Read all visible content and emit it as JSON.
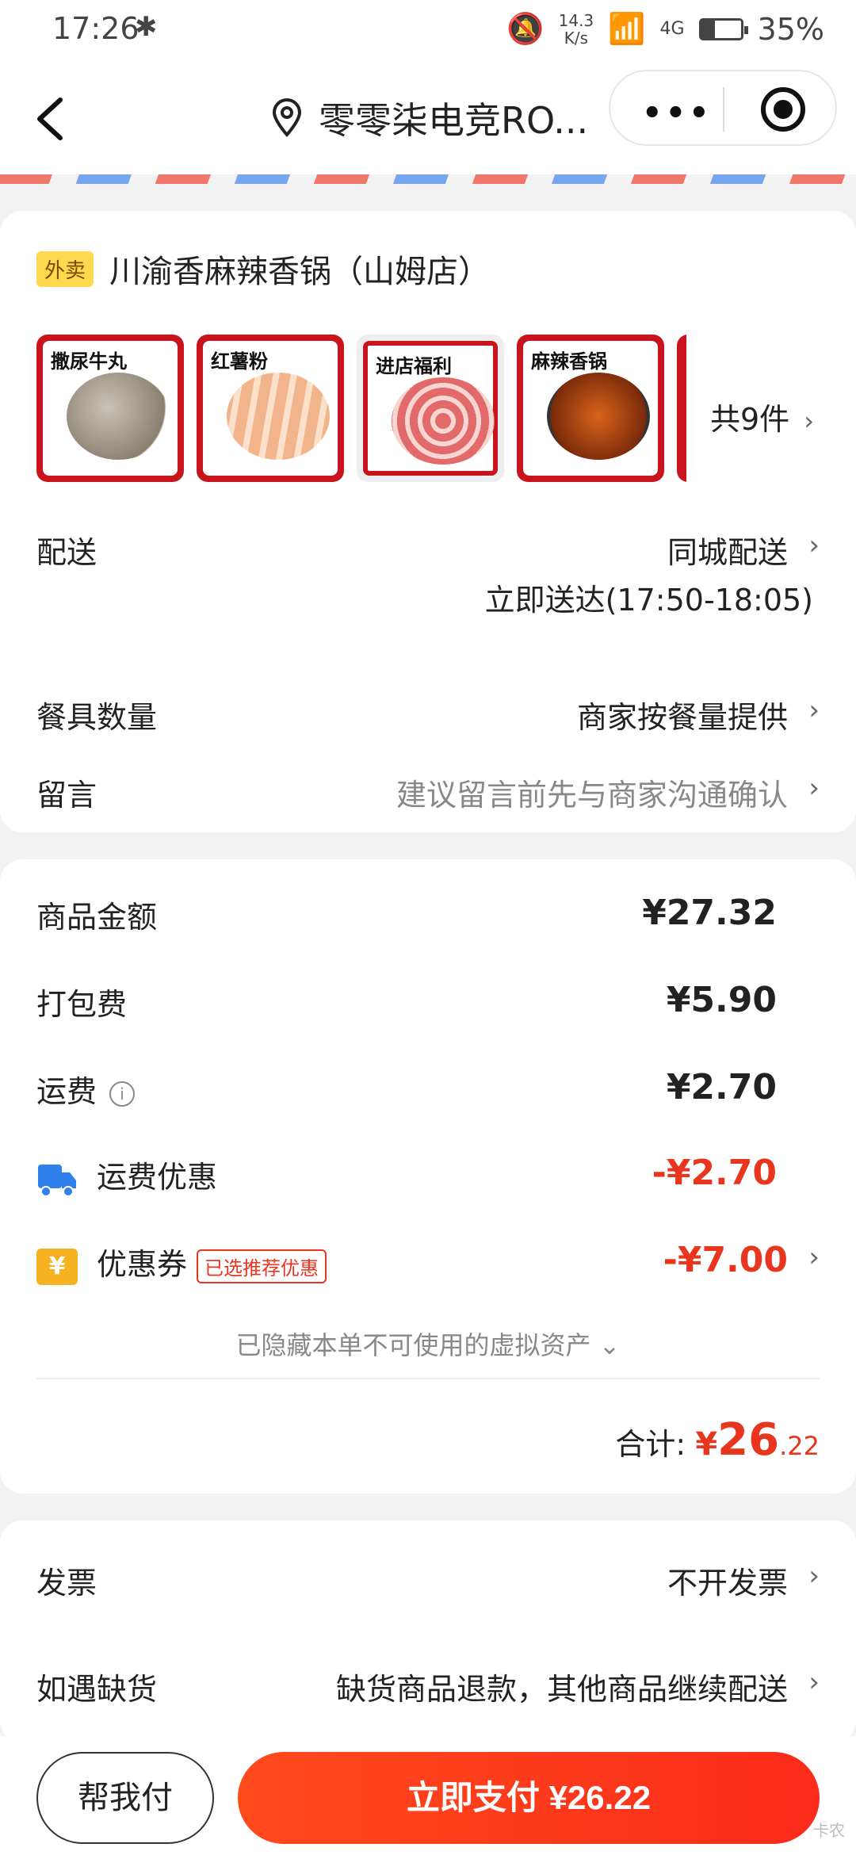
{
  "status_bar": {
    "time": "17:26",
    "bluetooth": "✱",
    "net_speed_value": "14.3",
    "net_speed_unit": "K/s",
    "signal": "4G",
    "battery": "35%"
  },
  "nav": {
    "title": "零零柒电竞RO...",
    "more_label": "•••"
  },
  "store": {
    "tag": "外卖",
    "name": "川渝香麻辣香锅（山姆店）"
  },
  "items": {
    "thumbs": [
      {
        "title": "撒尿牛丸"
      },
      {
        "title": "红薯粉"
      },
      {
        "title": "进店福利"
      },
      {
        "title": "麻辣香锅"
      }
    ],
    "count_label": "共9件"
  },
  "delivery": {
    "label": "配送",
    "method": "同城配送",
    "time": "立即送达(17:50-18:05)"
  },
  "tableware": {
    "label": "餐具数量",
    "value": "商家按餐量提供"
  },
  "message": {
    "label": "留言",
    "placeholder": "建议留言前先与商家沟通确认"
  },
  "fees": {
    "goods": {
      "label": "商品金额",
      "value": "¥27.32"
    },
    "packing": {
      "label": "打包费",
      "value": "¥5.90"
    },
    "shipping": {
      "label": "运费",
      "value": "¥2.70"
    },
    "shipping_discount": {
      "label": "运费优惠",
      "value": "-¥2.70"
    },
    "coupon": {
      "label": "优惠券",
      "badge": "已选推荐优惠",
      "value": "-¥7.00"
    }
  },
  "hidden_note": "已隐藏本单不可使用的虚拟资产 ⌄",
  "total": {
    "label": "合计:",
    "currency": "¥",
    "integer": "26",
    "decimal": ".22"
  },
  "invoice": {
    "label": "发票",
    "value": "不开发票"
  },
  "out_of_stock": {
    "label": "如遇缺货",
    "value": "缺货商品退款，其他商品继续配送"
  },
  "bottom": {
    "help_label": "帮我付",
    "pay_label": "立即支付 ¥26.22"
  },
  "watermark": "卡农",
  "colors": {
    "accent": "#e8361e",
    "tag": "#ffd84f",
    "coupon": "#f7b221",
    "truck": "#2f80ed"
  }
}
